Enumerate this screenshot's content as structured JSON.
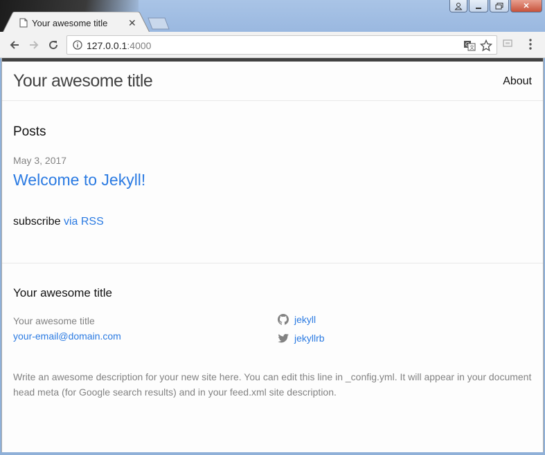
{
  "browser": {
    "tab_title": "Your awesome title",
    "url_host": "127.0.0.1",
    "url_port": ":4000"
  },
  "icons": {
    "back": "arrow-left-icon",
    "forward": "arrow-right-icon",
    "reload": "reload-icon",
    "info": "info-icon",
    "translate": "translate-icon",
    "bookmark": "star-icon",
    "cast": "cast-icon",
    "menu": "kebab-menu-icon",
    "github": "github-icon",
    "twitter": "twitter-icon"
  },
  "header": {
    "site_title": "Your awesome title",
    "nav_about": "About"
  },
  "main": {
    "posts_heading": "Posts",
    "posts": [
      {
        "date": "May 3, 2017",
        "title": "Welcome to Jekyll!"
      }
    ],
    "subscribe_text": "subscribe",
    "subscribe_link": "via RSS"
  },
  "footer": {
    "heading": "Your awesome title",
    "name": "Your awesome title",
    "email": "your-email@domain.com",
    "github_user": "jekyll",
    "twitter_user": "jekyllrb",
    "description": "Write an awesome description for your new site here. You can edit this line in _config.yml. It will appear in your document head meta (for Google search results) and in your feed.xml site description."
  },
  "colors": {
    "link": "#2a7ae2",
    "text": "#111111",
    "meta": "#828282",
    "top_bar": "#424242"
  }
}
